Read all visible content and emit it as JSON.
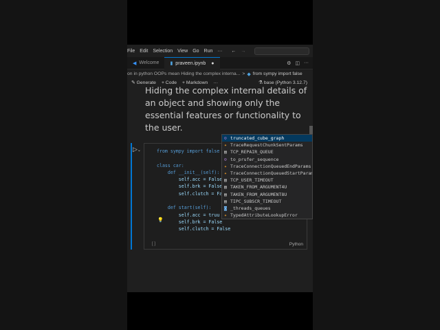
{
  "menu": [
    "File",
    "Edit",
    "Selection",
    "View",
    "Go",
    "Run",
    "···"
  ],
  "nav": {
    "back": "←",
    "forward": "→"
  },
  "tabs": [
    {
      "label": "Welcome"
    },
    {
      "label": "praveen.ipynb",
      "dirty": "●"
    }
  ],
  "tab_icons": [
    "⚙",
    "◫",
    "···"
  ],
  "breadcrumb": {
    "part1": "on in python OOPs mean Hiding the complex interna...",
    "sep": ">",
    "part2": "from sympy import false"
  },
  "toolbar": {
    "generate": "Generate",
    "code": "+ Code",
    "markdown": "+ Markdown",
    "more": "···",
    "kernel": "base (Python 3.12.7)"
  },
  "markdown_text": "Hiding the complex internal details of an object and showing only the essential features or functionality to the user.",
  "code_lines": [
    "from sympy import false",
    "",
    "class car:",
    "    def __init__(self):",
    "        self.acc = False",
    "        self.brk = False",
    "        self.clutch = False",
    "",
    "    def start(self):",
    "        self.acc = truu",
    "        self.brk = False",
    "        self.clutch = False"
  ],
  "cell_language": "Python",
  "cell_brackets": "[ ]",
  "autocomplete": [
    {
      "label": "truncated_cube_graph",
      "kind": "function"
    },
    {
      "label": "TraceRequestChunkSentParams",
      "kind": "class"
    },
    {
      "label": "TCP_REPAIR_QUEUE",
      "kind": "constant"
    },
    {
      "label": "to_prufer_sequence",
      "kind": "function"
    },
    {
      "label": "TraceConnectionQueuedEndParams",
      "kind": "class"
    },
    {
      "label": "TraceConnectionQueuedStartParams",
      "kind": "class"
    },
    {
      "label": "TCP_USER_TIMEOUT",
      "kind": "constant"
    },
    {
      "label": "TAKEN_FROM_ARGUMENT4U",
      "kind": "constant"
    },
    {
      "label": "TAKEN_FROM_ARGUMENT8U",
      "kind": "constant"
    },
    {
      "label": "TIPC_SUBSCR_TIMEOUT",
      "kind": "constant"
    },
    {
      "label": "_threads_queues",
      "kind": "module"
    },
    {
      "label": "TypedAttributeLookupError",
      "kind": "class"
    }
  ],
  "colors": {
    "accent": "#0078d4",
    "selection": "#04395e"
  }
}
